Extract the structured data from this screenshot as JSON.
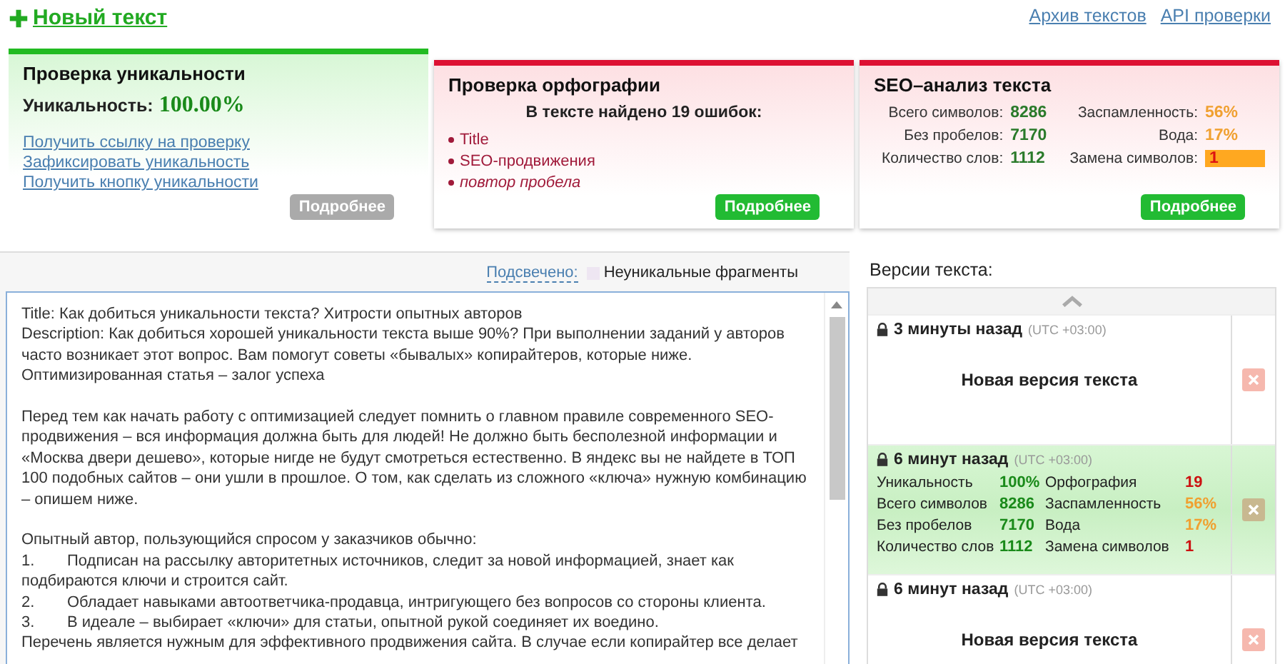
{
  "header": {
    "new_text": "Новый текст",
    "links": [
      "Архив текстов",
      "API проверки"
    ]
  },
  "cards": [
    {
      "kind": "uniqueness",
      "title": "Проверка уникальности",
      "score_label": "Уникальность:",
      "score": "100.00%",
      "links": [
        "Получить ссылку на проверку",
        "Зафиксировать уникальность",
        "Получить кнопку уникальности"
      ],
      "button": {
        "label": "Подробнее",
        "disabled": true
      }
    },
    {
      "kind": "spelling",
      "title": "Проверка орфографии",
      "summary": "В тексте найдено 19 ошибок:",
      "errors": [
        {
          "text": "Title",
          "italic": false
        },
        {
          "text": "SEO-продвижения",
          "italic": false
        },
        {
          "text": "повтор пробела",
          "italic": true
        }
      ],
      "button": {
        "label": "Подробнее",
        "disabled": false
      }
    },
    {
      "kind": "seo",
      "title": "SEO–анализ текста",
      "stats": [
        {
          "label": "Всего символов:",
          "value": "8286",
          "color": "#2a7a2a",
          "highlighted": false
        },
        {
          "label": "Заспамленность:",
          "value": "56%",
          "color": "#f0a030",
          "highlighted": false
        },
        {
          "label": "Без пробелов:",
          "value": "7170",
          "color": "#2a7a2a",
          "highlighted": false
        },
        {
          "label": "Вода:",
          "value": "17%",
          "color": "#f0a030",
          "highlighted": false
        },
        {
          "label": "Количество слов:",
          "value": "1112",
          "color": "#2a7a2a",
          "highlighted": false
        },
        {
          "label": "Замена символов:",
          "value": "1",
          "color": "#dd1111",
          "highlighted": true
        }
      ],
      "button": {
        "label": "Подробнее",
        "disabled": false
      }
    }
  ],
  "legend": {
    "label": "Подсвечено:",
    "item": "Неуникальные фрагменты"
  },
  "text_blocks": [
    [
      "Title: Как добиться уникальности текста? Хитрости опытных авторов",
      "Description: Как добиться хорошей уникальности текста выше 90%? При выполнении заданий у авторов часто возникает этот вопрос. Вам помогут советы «бывалых» копирайтеров, которые ниже.",
      "Оптимизированная статья – залог успеха"
    ],
    [
      "Перед тем как начать работу с оптимизацией следует помнить о главном правиле современного SEO-продвижения – вся информация должна быть для людей! Не должно быть бесполезной информации и «Москва двери дешево», которые нигде не будут смотреться естественно. В яндекс вы не найдете в ТОП 100 подобных сайтов – они ушли в прошлое. О том, как сделать из сложного «ключа» нужную комбинацию – опишем ниже."
    ],
    [
      "Опытный автор, пользующийся спросом у заказчиков обычно:",
      "1.\tПодписан на рассылку авторитетных источников, следит за новой информацией, знает как подбираются ключи и строится сайт.",
      "2.\tОбладает навыками автоответчика-продавца, интригующего без вопросов со стороны клиента.",
      "3.\tВ идеале – выбирает «ключи» для статьи, опытной рукой соединяет их воедино.",
      "Перечень является нужным для эффективного продвижения сайта. В случае если копирайтер все делает"
    ]
  ],
  "versions": {
    "title": "Версии текста:",
    "items": [
      {
        "kind": "empty",
        "time": "3 минуты назад",
        "zone": "(UTC +03:00)",
        "label": "Новая версия текста",
        "selected": false
      },
      {
        "kind": "stats",
        "time": "6 минут назад",
        "zone": "(UTC +03:00)",
        "selected": true,
        "stats": [
          [
            {
              "label": "Уникальность",
              "value": "100%",
              "color": "#1a8a1a"
            },
            {
              "label": "Орфография",
              "value": "19",
              "color": "#cc1111"
            }
          ],
          [
            {
              "label": "Всего символов",
              "value": "8286",
              "color": "#1a8a1a"
            },
            {
              "label": "Заспамленность",
              "value": "56%",
              "color": "#f0a030"
            }
          ],
          [
            {
              "label": "Без пробелов",
              "value": "7170",
              "color": "#1a8a1a"
            },
            {
              "label": "Вода",
              "value": "17%",
              "color": "#f0a030"
            }
          ],
          [
            {
              "label": "Количество слов",
              "value": "1112",
              "color": "#1a8a1a"
            },
            {
              "label": "Замена символов",
              "value": "1",
              "color": "#cc1111"
            }
          ]
        ]
      },
      {
        "kind": "empty",
        "time": "6 минут назад",
        "zone": "(UTC +03:00)",
        "label": "Новая версия текста",
        "selected": false
      }
    ]
  }
}
